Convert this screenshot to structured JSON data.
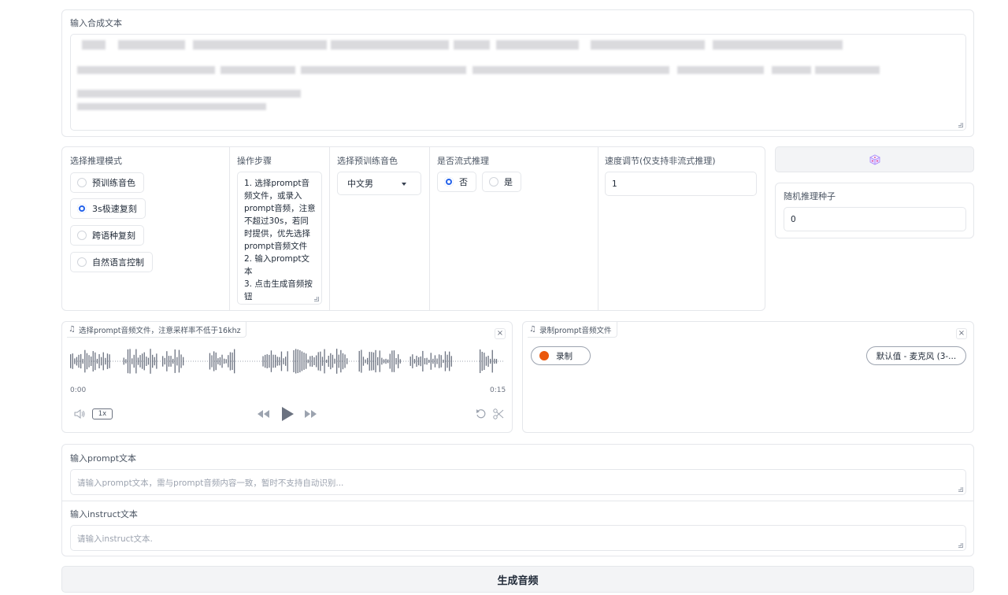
{
  "synthesis": {
    "label": "输入合成文本"
  },
  "mode": {
    "label": "选择推理模式",
    "options": [
      {
        "label": "预训练音色",
        "selected": false
      },
      {
        "label": "3s极速复刻",
        "selected": true
      },
      {
        "label": "跨语种复刻",
        "selected": false
      },
      {
        "label": "自然语言控制",
        "selected": false
      }
    ]
  },
  "steps": {
    "label": "操作步骤",
    "text": "1. 选择prompt音频文件，或录入prompt音频，注意不超过30s，若同时提供，优先选择prompt音频文件\n2. 输入prompt文本\n3. 点击生成音频按钮"
  },
  "speaker": {
    "label": "选择预训练音色",
    "value": "中文男"
  },
  "stream": {
    "label": "是否流式推理",
    "options": [
      {
        "label": "否",
        "selected": true
      },
      {
        "label": "是",
        "selected": false
      }
    ]
  },
  "speed": {
    "label": "速度调节(仅支持非流式推理)",
    "value": "1"
  },
  "seed": {
    "dice_icon": "dice-icon",
    "label": "随机推理种子",
    "value": "0"
  },
  "upload_audio": {
    "label": "选择prompt音频文件，注意采样率不低于16khz",
    "close": "×",
    "time_start": "0:00",
    "time_end": "0:15",
    "speed": "1x",
    "playback": 0
  },
  "record_audio": {
    "label": "录制prompt音频文件",
    "close": "×",
    "record_label": "录制",
    "mic_device": "默认值 - 麦克风 (3-..."
  },
  "prompt_text": {
    "label": "输入prompt文本",
    "placeholder": "请输入prompt文本，需与prompt音频内容一致，暂时不支持自动识别..."
  },
  "instruct_text": {
    "label": "输入instruct文本",
    "placeholder": "请输入instruct文本."
  },
  "generate": {
    "label": "生成音频"
  },
  "colors": {
    "accent": "#2563eb",
    "record": "#ea580c",
    "border": "#e5e7eb"
  }
}
